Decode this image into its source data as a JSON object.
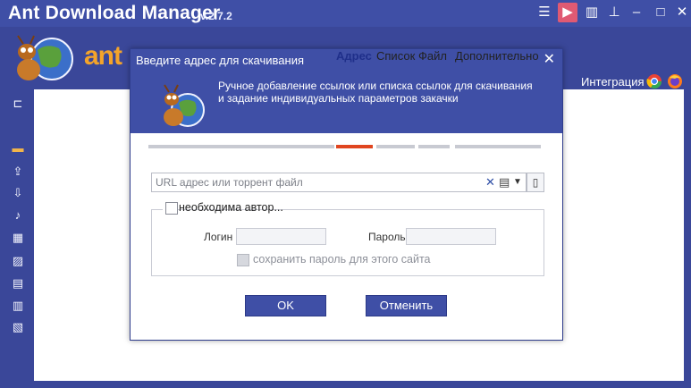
{
  "app": {
    "title": "Ant Download Manager",
    "version": "v.2.7.2",
    "brand_text": "ant",
    "integration_label": "Интеграция",
    "colors": {
      "titlebar": "#3f4fa6",
      "background": "#3a4799",
      "accent": "#e0451f",
      "play_button": "#e05a73"
    }
  },
  "titlebar_icons": [
    "menu-icon",
    "play-icon",
    "equalizer-icon",
    "pin-icon",
    "minimize-icon",
    "close-icon"
  ],
  "sidebar_icons": [
    "tree-icon",
    "folder-icon",
    "upload-icon",
    "download-icon",
    "audio-icon",
    "video-icon",
    "image-icon",
    "archive-icon",
    "document-icon",
    "program-icon"
  ],
  "dialog": {
    "title": "Введите адрес для скачивания",
    "header_text": "Ручное добавление ссылок или списка ссылок для скачивания и задание индивидуальных параметров закачки",
    "tabs": [
      {
        "label": "Адрес",
        "active": true
      },
      {
        "label": "Список",
        "active": false
      },
      {
        "label": "Файл",
        "active": false
      },
      {
        "label": "Дополнительно",
        "active": false
      }
    ],
    "url_field": {
      "placeholder": "URL адрес или торрент файл",
      "value": ""
    },
    "auth": {
      "checkbox_label": "необходима автор...",
      "checked": false,
      "login_label": "Логин",
      "password_label": "Пароль",
      "save_password_label": "сохранить пароль для этого сайта"
    },
    "ok_label": "OK",
    "cancel_label": "Отменить"
  }
}
